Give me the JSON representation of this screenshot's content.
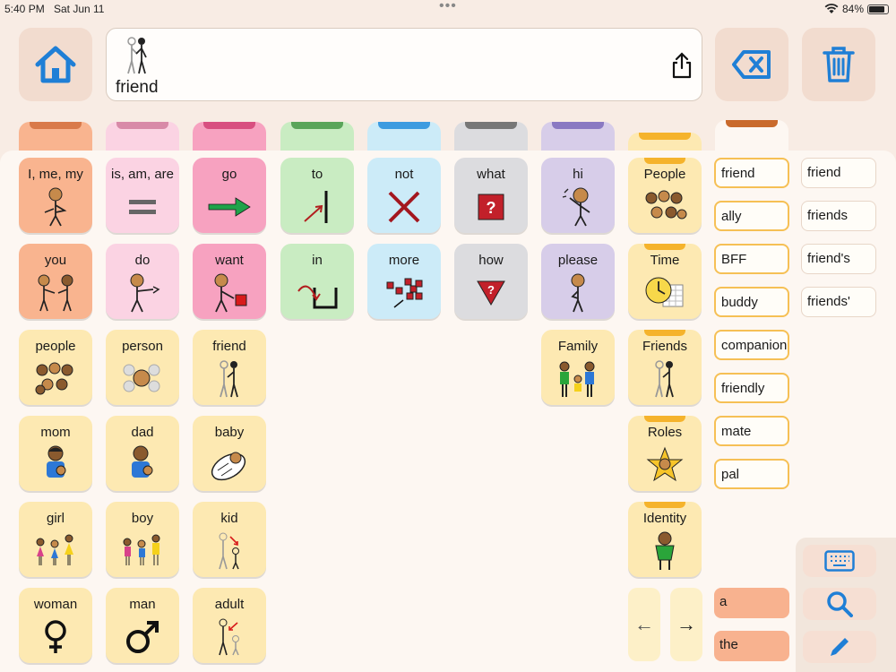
{
  "status_bar": {
    "time": "5:40 PM",
    "date": "Sat Jun 11",
    "dots": "•••",
    "battery": "84%"
  },
  "message_bar": {
    "word": "friend"
  },
  "icons": {
    "home": "home-icon",
    "share": "share-icon",
    "backspace": "backspace-icon",
    "trash": "trash-icon",
    "keyboard": "keyboard-icon",
    "search": "search-icon",
    "edit": "pencil-icon",
    "prev": "arrow-left-icon",
    "next": "arrow-right-icon"
  },
  "grid": {
    "row1": [
      "I, me, my",
      "is, am, are",
      "go",
      "to",
      "not",
      "what",
      "hi"
    ],
    "row2": [
      "you",
      "do",
      "want",
      "in",
      "more",
      "how",
      "please"
    ],
    "row3": [
      "people",
      "person",
      "friend"
    ],
    "row3_folder": "Family",
    "row4": [
      "mom",
      "dad",
      "baby"
    ],
    "row5": [
      "girl",
      "boy",
      "kid"
    ],
    "row6": [
      "woman",
      "man",
      "adult"
    ]
  },
  "folders": [
    "People",
    "Time",
    "Friends",
    "Roles",
    "Identity"
  ],
  "word_list": [
    "friend",
    "ally",
    "BFF",
    "buddy",
    "companion",
    "friendly",
    "mate",
    "pal"
  ],
  "word_forms": [
    "friend",
    "friends",
    "friend's",
    "friends'"
  ],
  "articles": [
    "a",
    "the"
  ],
  "nav": {
    "prev": "←",
    "next": "→"
  },
  "colors": {
    "orange": "#f9b48f",
    "pink": "#fbd3e3",
    "magenta": "#f7a2c0",
    "green": "#c9ecc2",
    "blue": "#ccebf8",
    "grey": "#dcdcdf",
    "purple": "#d7cde9",
    "yellow": "#fde9b2",
    "accent_blue": "#1f7fd6"
  }
}
